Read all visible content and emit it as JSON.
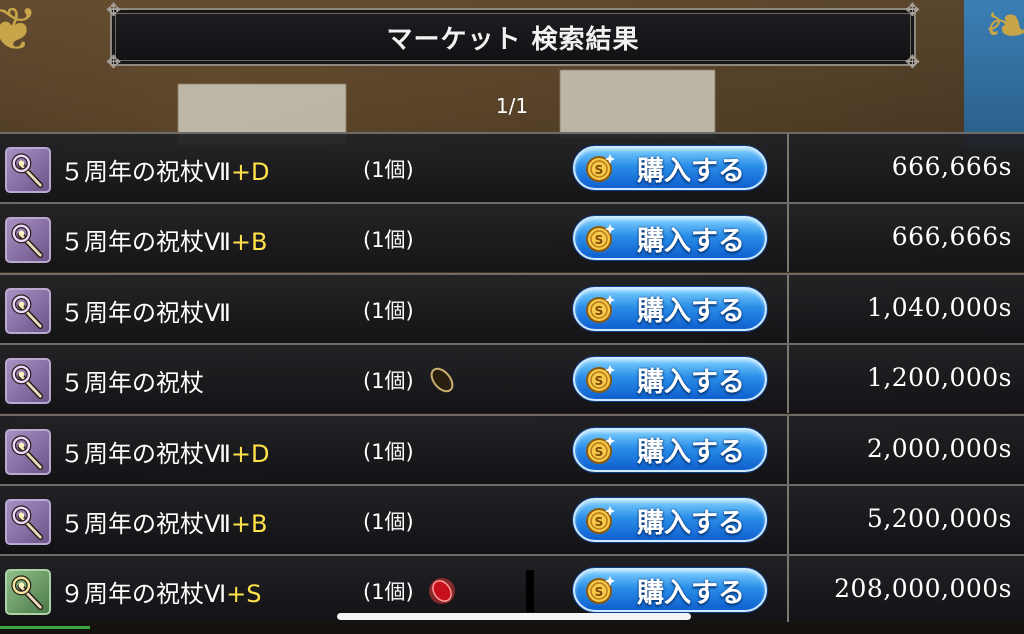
{
  "title": "マーケット 検索結果",
  "page_indicator": "1/1",
  "buy_label": "購入する",
  "colors": {
    "grade": "#ffe34a",
    "buy_button": "#2a8ee8",
    "title_border": "#8e8a80"
  },
  "rows": [
    {
      "name": "５周年の祝杖Ⅶ",
      "grade": "+D",
      "qty": "(1個)",
      "badge": "",
      "price": "666,666s",
      "icon": "staff-icon"
    },
    {
      "name": "５周年の祝杖Ⅶ",
      "grade": "+B",
      "qty": "(1個)",
      "badge": "",
      "price": "666,666s",
      "icon": "staff-icon"
    },
    {
      "name": "５周年の祝杖Ⅶ",
      "grade": "",
      "qty": "(1個)",
      "badge": "",
      "price": "1,040,000s",
      "icon": "staff-icon"
    },
    {
      "name": "５周年の祝杖",
      "grade": "",
      "qty": "(1個)",
      "badge": "seed-icon",
      "price": "1,200,000s",
      "icon": "staff-icon"
    },
    {
      "name": "５周年の祝杖Ⅶ",
      "grade": "+D",
      "qty": "(1個)",
      "badge": "",
      "price": "2,000,000s",
      "icon": "staff-icon"
    },
    {
      "name": "５周年の祝杖Ⅶ",
      "grade": "+B",
      "qty": "(1個)",
      "badge": "",
      "price": "5,200,000s",
      "icon": "staff-icon"
    },
    {
      "name": "９周年の祝杖Ⅵ",
      "grade": "+S",
      "qty": "(1個)",
      "badge": "red-gem-icon",
      "price": "208,000,000s",
      "icon": "staff-icon-green"
    }
  ]
}
